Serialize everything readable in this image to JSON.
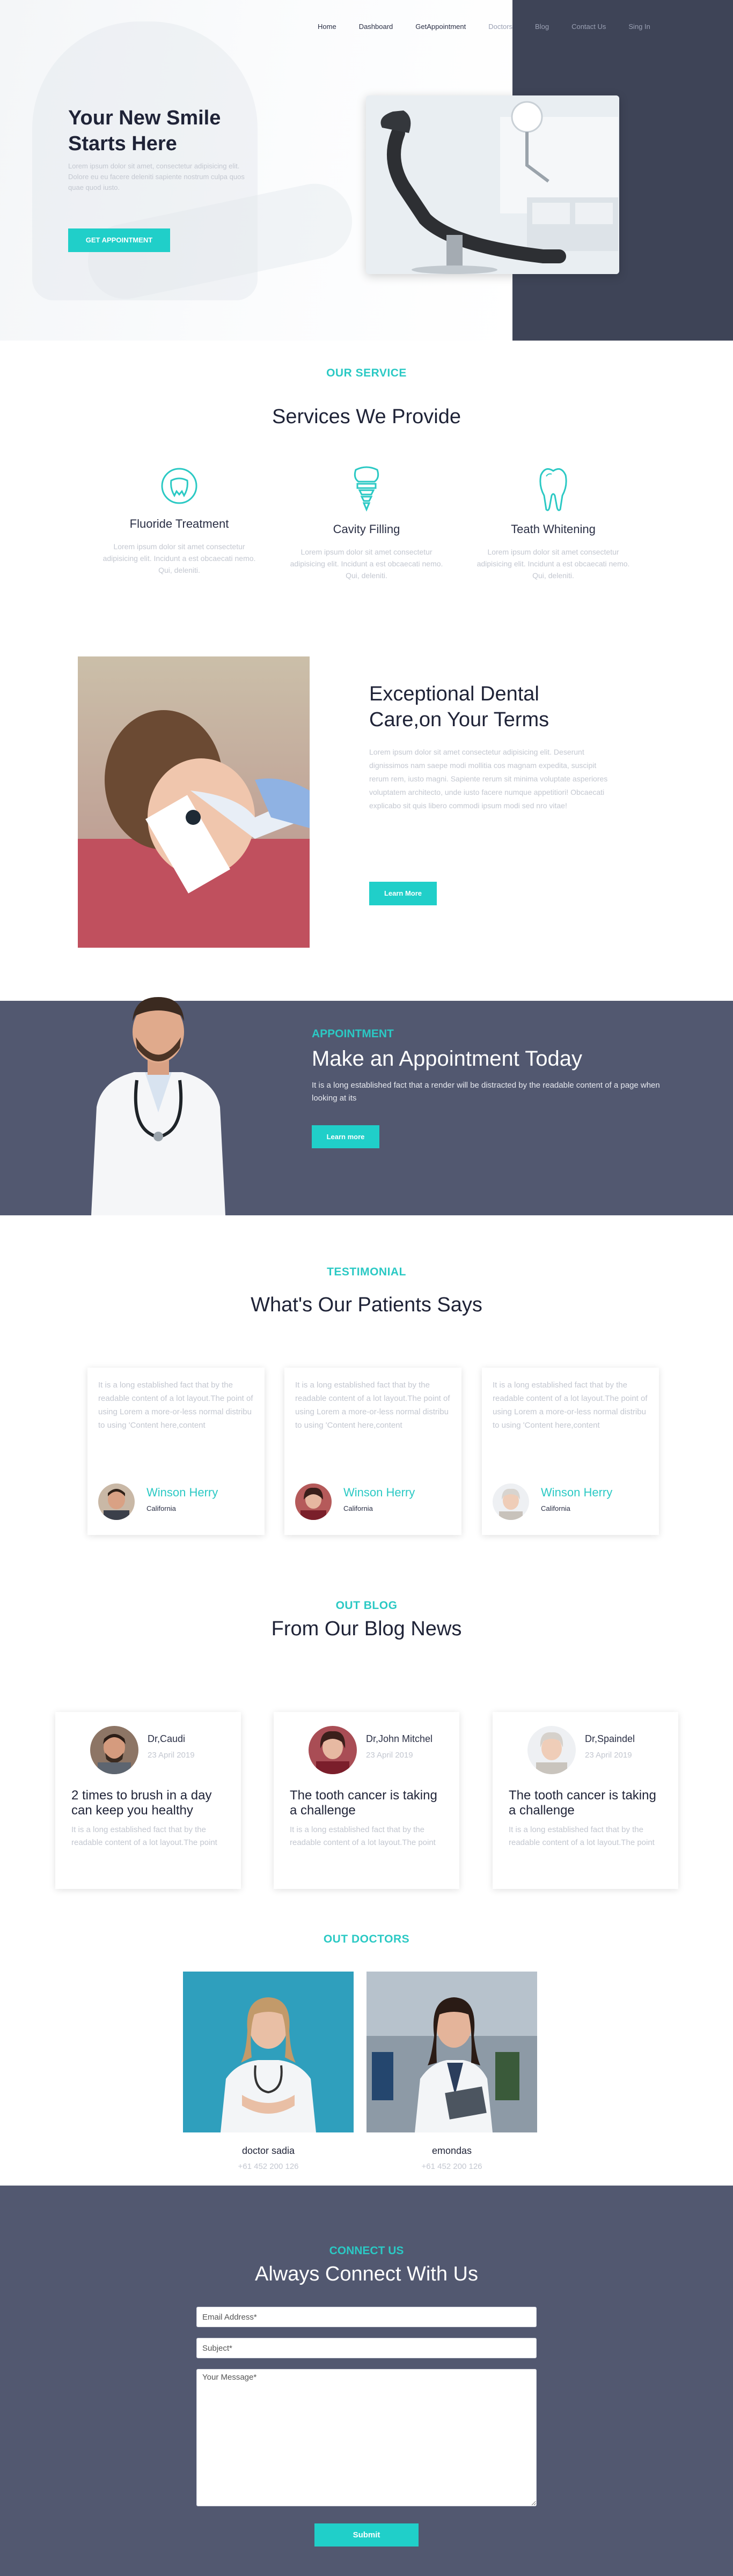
{
  "nav": {
    "items": [
      {
        "label": "Home"
      },
      {
        "label": "Dashboard"
      },
      {
        "label": "GetAppointment"
      },
      {
        "label": "Doctors"
      },
      {
        "label": "Blog"
      },
      {
        "label": "Contact Us"
      },
      {
        "label": "Sing In"
      }
    ]
  },
  "hero": {
    "title": "Your New Smile Starts Here",
    "text": "Lorem ipsum dolor sit amet, consectetur adipisicing elit. Dolore eu eu facere deleniti sapiente nostrum culpa quos quae quod iusto.",
    "button": "GET APPOINTMENT"
  },
  "services": {
    "label": "OUR SERVICE",
    "title": "Services We Provide",
    "items": [
      {
        "icon": "tooth-shield-icon",
        "title": "Fluoride Treatment",
        "text": "Lorem ipsum dolor sit amet consectetur adipisicing elit. Incidunt a est obcaecati nemo. Qui, deleniti."
      },
      {
        "icon": "dental-implant-icon",
        "title": "Cavity Filling",
        "text": "Lorem ipsum dolor sit amet consectetur adipisicing elit. Incidunt a est obcaecati nemo. Qui, deleniti."
      },
      {
        "icon": "tooth-icon",
        "title": "Teath Whitening",
        "text": "Lorem ipsum dolor sit amet consectetur adipisicing elit. Incidunt a est obcaecati nemo. Qui, deleniti."
      }
    ]
  },
  "feature": {
    "title": "Exceptional Dental Care,on Your Terms",
    "text": "Lorem ipsum dolor sit amet consectetur adipisicing elit. Deserunt dignissimos nam saepe modi mollitia cos magnam expedita, suscipit rerum rem, iusto magni. Sapiente rerum sit minima voluptate asperiores voluptatem architecto, unde iusto facere numque appetitiori! Obcaecati explicabo sit quis libero commodi ipsum modi sed nro vitae!",
    "button": "Learn More"
  },
  "appointment": {
    "label": "APPOINTMENT",
    "title": "Make an Appointment Today",
    "text": "It is a long established fact that a render will be distracted by the readable content of a page when looking at its",
    "button": "Learn more"
  },
  "testimonials": {
    "label": "TESTIMONIAL",
    "title": "What's Our Patients Says",
    "items": [
      {
        "text": "It is a long established fact that by the readable content of a lot layout.The point of using Lorem a more-or-less normal distribu to using 'Content here,content",
        "name": "Winson Herry",
        "location": "California"
      },
      {
        "text": "It is a long established fact that by the readable content of a lot layout.The point of using Lorem a more-or-less normal distribu to using 'Content here,content",
        "name": "Winson Herry",
        "location": "California"
      },
      {
        "text": "It is a long established fact that by the readable content of a lot layout.The point of using Lorem a more-or-less normal distribu to using 'Content here,content",
        "name": "Winson Herry",
        "location": "California"
      }
    ]
  },
  "blog": {
    "label": "OUT BLOG",
    "title": "From Our Blog News",
    "items": [
      {
        "author": "Dr,Caudi",
        "date": "23 April 2019",
        "title": "2 times to brush in a day can keep you healthy",
        "text": "It is a long established fact that by the readable content of a lot layout.The point"
      },
      {
        "author": "Dr,John Mitchel",
        "date": "23 April 2019",
        "title": "The tooth cancer is taking a challenge",
        "text": "It is a long established fact that by the readable content of a lot layout.The point"
      },
      {
        "author": "Dr,Spaindel",
        "date": "23 April 2019",
        "title": "The tooth cancer is taking a challenge",
        "text": "It is a long established fact that by the readable content of a lot layout.The point"
      }
    ]
  },
  "doctors": {
    "label": "OUT DOCTORS",
    "items": [
      {
        "name": "doctor sadia",
        "phone": "+61 452 200 126"
      },
      {
        "name": "emondas",
        "phone": "+61 452 200 126"
      }
    ]
  },
  "contact": {
    "label": "CONNECT US",
    "title": "Always Connect With Us",
    "email_placeholder": "Email Address*",
    "subject_placeholder": "Subject*",
    "message_placeholder": "Your Message*",
    "button": "Submit"
  },
  "colors": {
    "accent": "#20cfc9",
    "dark": "#525870",
    "hero_dark": "#3e4457"
  }
}
